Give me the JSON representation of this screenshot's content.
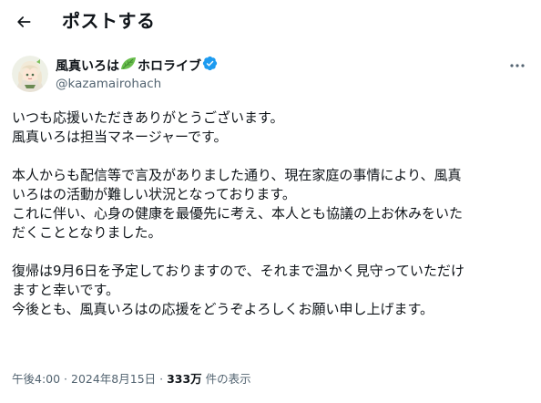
{
  "header": {
    "title": "ポストする",
    "back_icon": "arrow-left-icon"
  },
  "author": {
    "name_before": "風真いろは",
    "name_after": "ホロライブ",
    "handle": "@kazamairohach",
    "name_icon": "leaf-icon",
    "verified_icon": "verified-badge-icon",
    "verified_color": "#1d9bf0"
  },
  "more_icon": "more-horizontal-icon",
  "post": {
    "lines": [
      "いつも応援いただきありがとうございます。",
      "風真いろは担当マネージャーです。",
      "",
      "本人からも配信等で言及がありました通り、現在家庭の事情により、風真",
      "いろはの活動が難しい状況となっております。",
      "これに伴い、心身の健康を最優先に考え、本人とも協議の上お休みをいた",
      "だくこととなりました。",
      "",
      "復帰は9月6日を予定しておりますので、それまで温かく見守っていただけ",
      "ますと幸いです。",
      "今後とも、風真いろはの応援をどうぞよろしくお願い申し上げます。"
    ]
  },
  "meta": {
    "time": "午後4:00",
    "separator": " · ",
    "date": "2024年8月15日",
    "views_count": "333万",
    "views_label": " 件の表示"
  },
  "colors": {
    "text": "#0f1419",
    "secondary": "#536471",
    "leaf": "#6bbf4e"
  }
}
